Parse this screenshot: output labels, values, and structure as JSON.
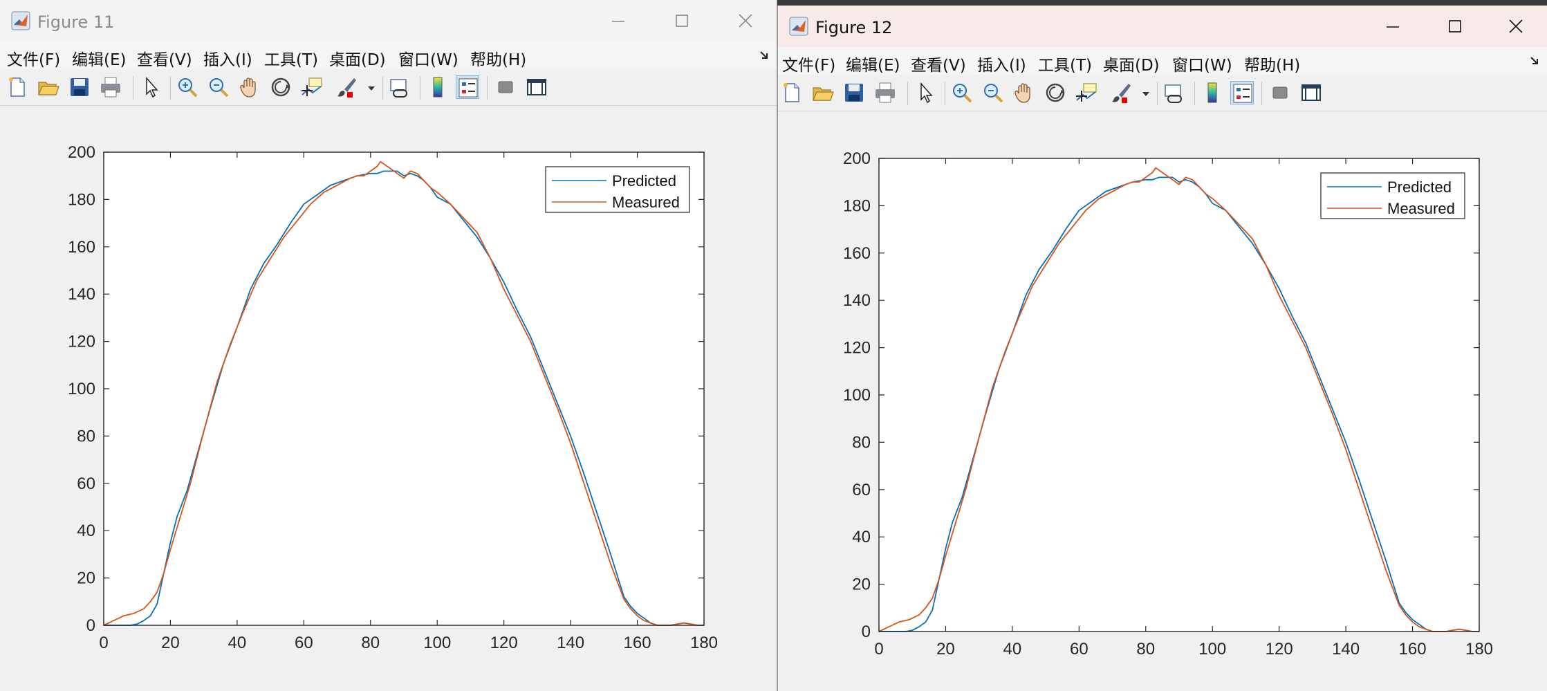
{
  "figures": [
    {
      "title": "Figure 11",
      "menu": [
        "文件(F)",
        "编辑(E)",
        "查看(V)",
        "插入(I)",
        "工具(T)",
        "桌面(D)",
        "窗口(W)",
        "帮助(H)"
      ],
      "toolbar_icons": [
        "new-figure-icon",
        "open-file-icon",
        "save-icon",
        "print-icon",
        "select-arrow-icon",
        "zoom-in-icon",
        "zoom-out-icon",
        "pan-hand-icon",
        "rotate-3d-icon",
        "data-cursor-icon",
        "brush-icon",
        "link-plot-icon",
        "colorbar-icon",
        "legend-icon",
        "hide-plot-tools-icon",
        "show-plot-tools-icon"
      ],
      "legend": [
        "Predicted",
        "Measured"
      ],
      "ticks": {
        "x": [
          "0",
          "20",
          "40",
          "60",
          "80",
          "100",
          "120",
          "140",
          "160",
          "180"
        ],
        "y": [
          "0",
          "20",
          "40",
          "60",
          "80",
          "100",
          "120",
          "140",
          "160",
          "180",
          "200"
        ]
      }
    },
    {
      "title": "Figure 12",
      "menu": [
        "文件(F)",
        "编辑(E)",
        "查看(V)",
        "插入(I)",
        "工具(T)",
        "桌面(D)",
        "窗口(W)",
        "帮助(H)"
      ],
      "toolbar_icons": [
        "new-figure-icon",
        "open-file-icon",
        "save-icon",
        "print-icon",
        "select-arrow-icon",
        "zoom-in-icon",
        "zoom-out-icon",
        "pan-hand-icon",
        "rotate-3d-icon",
        "data-cursor-icon",
        "brush-icon",
        "link-plot-icon",
        "colorbar-icon",
        "legend-icon",
        "hide-plot-tools-icon",
        "show-plot-tools-icon"
      ],
      "legend": [
        "Predicted",
        "Measured"
      ],
      "ticks": {
        "x": [
          "0",
          "20",
          "40",
          "60",
          "80",
          "100",
          "120",
          "140",
          "160",
          "180"
        ],
        "y": [
          "0",
          "20",
          "40",
          "60",
          "80",
          "100",
          "120",
          "140",
          "160",
          "180",
          "200"
        ]
      }
    }
  ],
  "colors": {
    "predicted": "#0072BD",
    "measured": "#D95319",
    "accent": "#0078d7"
  },
  "chart_data": [
    {
      "type": "line",
      "title": "",
      "xlabel": "",
      "ylabel": "",
      "xlim": [
        0,
        180
      ],
      "ylim": [
        0,
        200
      ],
      "grid": false,
      "legend_position": "top-right",
      "series": [
        {
          "name": "Predicted",
          "color": "#0072BD",
          "x": [
            0,
            5,
            8,
            10,
            12,
            14,
            16,
            18,
            20,
            22,
            25,
            28,
            32,
            36,
            40,
            44,
            48,
            52,
            56,
            60,
            64,
            68,
            72,
            76,
            80,
            82,
            84,
            86,
            88,
            90,
            92,
            94,
            96,
            98,
            100,
            104,
            108,
            112,
            116,
            120,
            124,
            128,
            132,
            136,
            140,
            144,
            148,
            152,
            156,
            158,
            160,
            162,
            164,
            166,
            168,
            170,
            172,
            174,
            176,
            178,
            180
          ],
          "y": [
            0,
            0,
            0,
            0.5,
            2,
            4,
            9,
            22,
            35,
            46,
            57,
            72,
            92,
            111,
            126,
            142,
            153,
            161,
            170,
            178,
            182,
            186,
            188,
            190,
            191,
            191,
            192,
            192,
            192,
            190,
            191,
            190,
            188,
            185,
            181,
            178,
            171,
            164,
            155,
            145,
            133,
            122,
            108,
            94,
            80,
            64,
            47,
            30,
            12,
            8,
            5,
            3,
            1,
            0,
            0,
            0,
            0.5,
            1,
            0.5,
            0,
            0
          ]
        },
        {
          "name": "Measured",
          "color": "#D95319",
          "x": [
            0,
            3,
            6,
            9,
            12,
            14,
            16,
            18,
            20,
            23,
            26,
            30,
            34,
            38,
            42,
            46,
            50,
            54,
            58,
            62,
            66,
            70,
            74,
            76,
            78,
            80,
            82,
            83,
            84,
            86,
            88,
            90,
            92,
            94,
            96,
            98,
            100,
            104,
            108,
            112,
            116,
            120,
            124,
            128,
            132,
            136,
            140,
            144,
            148,
            152,
            156,
            158,
            160,
            162,
            164,
            166,
            168,
            170,
            172,
            174,
            176,
            178,
            180
          ],
          "y": [
            0,
            2,
            4,
            5,
            7,
            10,
            14,
            22,
            32,
            46,
            60,
            82,
            103,
            119,
            133,
            146,
            155,
            164,
            171,
            178,
            183,
            186,
            189,
            190,
            190,
            192,
            194,
            196,
            195,
            193,
            191,
            189,
            192,
            191,
            188,
            185,
            183,
            178,
            172,
            166,
            155,
            142,
            131,
            120,
            106,
            92,
            77,
            60,
            43,
            26,
            11,
            7,
            4,
            2,
            1,
            0,
            0,
            0,
            0.5,
            1,
            0.5,
            0,
            0
          ]
        }
      ]
    },
    {
      "type": "line",
      "title": "",
      "xlabel": "",
      "ylabel": "",
      "xlim": [
        0,
        180
      ],
      "ylim": [
        0,
        200
      ],
      "grid": false,
      "legend_position": "top-right",
      "series": [
        {
          "name": "Predicted",
          "color": "#0072BD",
          "x": [
            0,
            5,
            8,
            10,
            12,
            14,
            16,
            18,
            20,
            22,
            25,
            28,
            32,
            36,
            40,
            44,
            48,
            52,
            56,
            60,
            64,
            68,
            72,
            76,
            80,
            82,
            84,
            86,
            88,
            90,
            92,
            94,
            96,
            98,
            100,
            104,
            108,
            112,
            116,
            120,
            124,
            128,
            132,
            136,
            140,
            144,
            148,
            152,
            156,
            158,
            160,
            162,
            164,
            166,
            168,
            170,
            172,
            174,
            176,
            178,
            180
          ],
          "y": [
            0,
            0,
            0,
            0.5,
            2,
            4,
            9,
            22,
            35,
            46,
            57,
            72,
            92,
            111,
            126,
            142,
            153,
            161,
            170,
            178,
            182,
            186,
            188,
            190,
            191,
            191,
            192,
            192,
            192,
            190,
            191,
            190,
            188,
            185,
            181,
            178,
            171,
            164,
            155,
            145,
            133,
            122,
            108,
            94,
            80,
            64,
            47,
            30,
            12,
            8,
            5,
            3,
            1,
            0,
            0,
            0,
            0.5,
            1,
            0.5,
            0,
            0
          ]
        },
        {
          "name": "Measured",
          "color": "#D95319",
          "x": [
            0,
            3,
            6,
            9,
            12,
            14,
            16,
            18,
            20,
            23,
            26,
            30,
            34,
            38,
            42,
            46,
            50,
            54,
            58,
            62,
            66,
            70,
            74,
            76,
            78,
            80,
            82,
            83,
            84,
            86,
            88,
            90,
            92,
            94,
            96,
            98,
            100,
            104,
            108,
            112,
            116,
            120,
            124,
            128,
            132,
            136,
            140,
            144,
            148,
            152,
            156,
            158,
            160,
            162,
            164,
            166,
            168,
            170,
            172,
            174,
            176,
            178,
            180
          ],
          "y": [
            0,
            2,
            4,
            5,
            7,
            10,
            14,
            22,
            32,
            46,
            60,
            82,
            103,
            119,
            133,
            146,
            155,
            164,
            171,
            178,
            183,
            186,
            189,
            190,
            190,
            192,
            194,
            196,
            195,
            193,
            191,
            189,
            192,
            191,
            188,
            185,
            183,
            178,
            172,
            166,
            155,
            142,
            131,
            120,
            106,
            92,
            77,
            60,
            43,
            26,
            11,
            7,
            4,
            2,
            1,
            0,
            0,
            0,
            0.5,
            1,
            0.5,
            0,
            0
          ]
        }
      ]
    }
  ]
}
